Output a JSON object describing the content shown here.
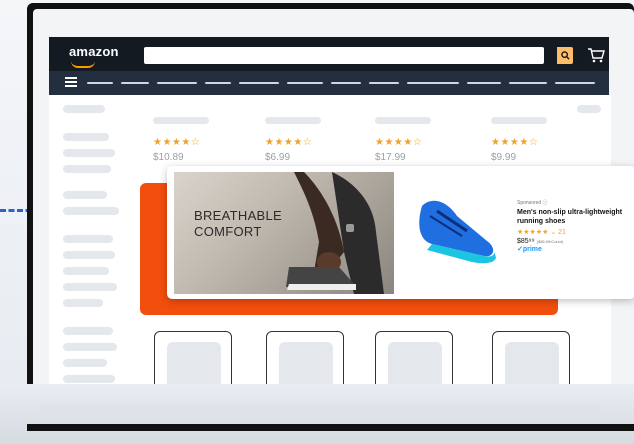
{
  "header": {
    "logo_text": "amazon",
    "search": {
      "placeholder": "",
      "button_icon": "search-icon"
    },
    "cart_icon": "cart-icon",
    "menu_icon": "hamburger-menu-icon"
  },
  "products": [
    {
      "stars": "★★★★☆",
      "price": "$10.89"
    },
    {
      "stars": "★★★★☆",
      "price": "$6.99"
    },
    {
      "stars": "★★★★☆",
      "price": "$17.99"
    },
    {
      "stars": "★★★★☆",
      "price": "$9.99"
    }
  ],
  "ad": {
    "headline_line1": "BREATHABLE",
    "headline_line2": "COMFORT",
    "sponsored": "Sponsored ⓘ",
    "title": "Men's non-slip ultra-lightweight running shoes",
    "stars": "★★★★★ ⌄ 21",
    "price_main": "$85⁹⁹",
    "price_unit": "($85.99/Count)",
    "prime": "✓prime"
  },
  "colors": {
    "nav_dark": "#131a22",
    "nav_secondary": "#232f3e",
    "accent_orange": "#f24e0e",
    "search_button": "#febd69",
    "star": "#f0a22b",
    "prime_blue": "#1a98ff"
  }
}
